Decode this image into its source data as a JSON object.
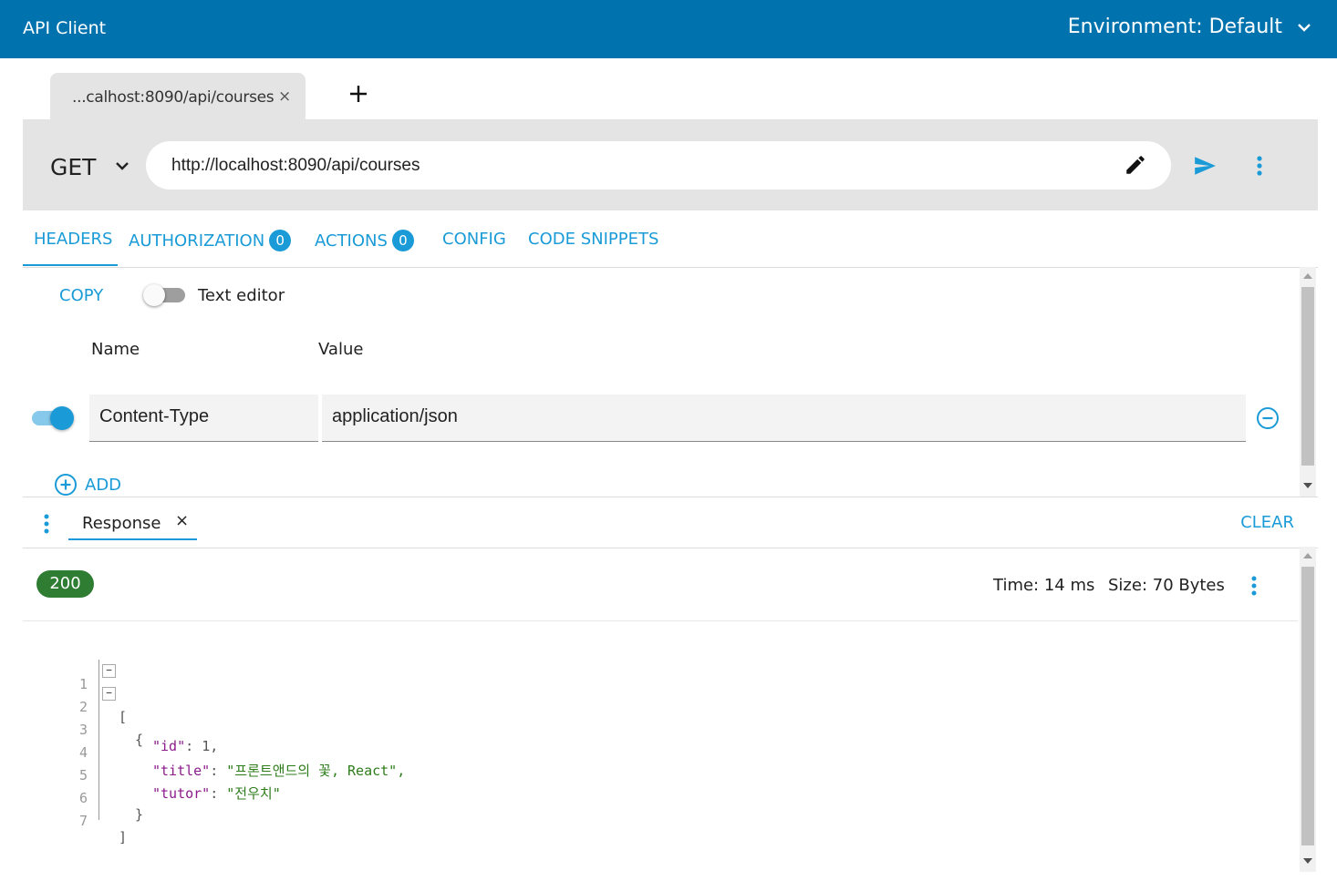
{
  "appbar": {
    "title": "API Client",
    "environment_label": "Environment: Default",
    "environment_icon": "chevron-down-icon",
    "color": "#0072ae"
  },
  "request_tab": {
    "label": "...calhost:8090/api/courses",
    "close": "×",
    "add_icon": "plus-icon"
  },
  "request": {
    "method": "GET",
    "url": "http://localhost:8090/api/courses",
    "edit_icon": "pencil-icon",
    "send_icon": "send-icon",
    "more_icon": "more-vert-icon"
  },
  "subtabs": [
    {
      "label": "HEADERS",
      "active": true
    },
    {
      "label": "AUTHORIZATION",
      "badge": "0"
    },
    {
      "label": "ACTIONS",
      "badge": "0"
    },
    {
      "label": "CONFIG"
    },
    {
      "label": "CODE SNIPPETS"
    }
  ],
  "headers_panel": {
    "copy_label": "COPY",
    "text_editor_label": "Text editor",
    "text_editor_enabled": false,
    "name_column": "Name",
    "value_column": "Value",
    "rows": [
      {
        "enabled": true,
        "name": "Content-Type",
        "value": "application/json"
      }
    ],
    "add_label": "ADD"
  },
  "response": {
    "tab_label": "Response",
    "tab_close": "×",
    "clear_label": "CLEAR",
    "status": "200",
    "status_color": "#2e7d32",
    "time": "Time: 14 ms",
    "size": "Size: 70 Bytes",
    "lines": [
      {
        "n": "1",
        "fold": "−",
        "text": "["
      },
      {
        "n": "2",
        "fold": "−",
        "text": "  {"
      },
      {
        "n": "3",
        "key": "\"id\"",
        "sep": ": ",
        "val": "1,",
        "val_kind": "n"
      },
      {
        "n": "4",
        "key": "\"title\"",
        "sep": ": ",
        "val": "\"프론트앤드의 꽃, React\",",
        "val_kind": "s"
      },
      {
        "n": "5",
        "key": "\"tutor\"",
        "sep": ": ",
        "val": "\"전우치\"",
        "val_kind": "s"
      },
      {
        "n": "6",
        "text": "  }"
      },
      {
        "n": "7",
        "text": "]"
      }
    ]
  },
  "accent_color": "#1a9bd7"
}
